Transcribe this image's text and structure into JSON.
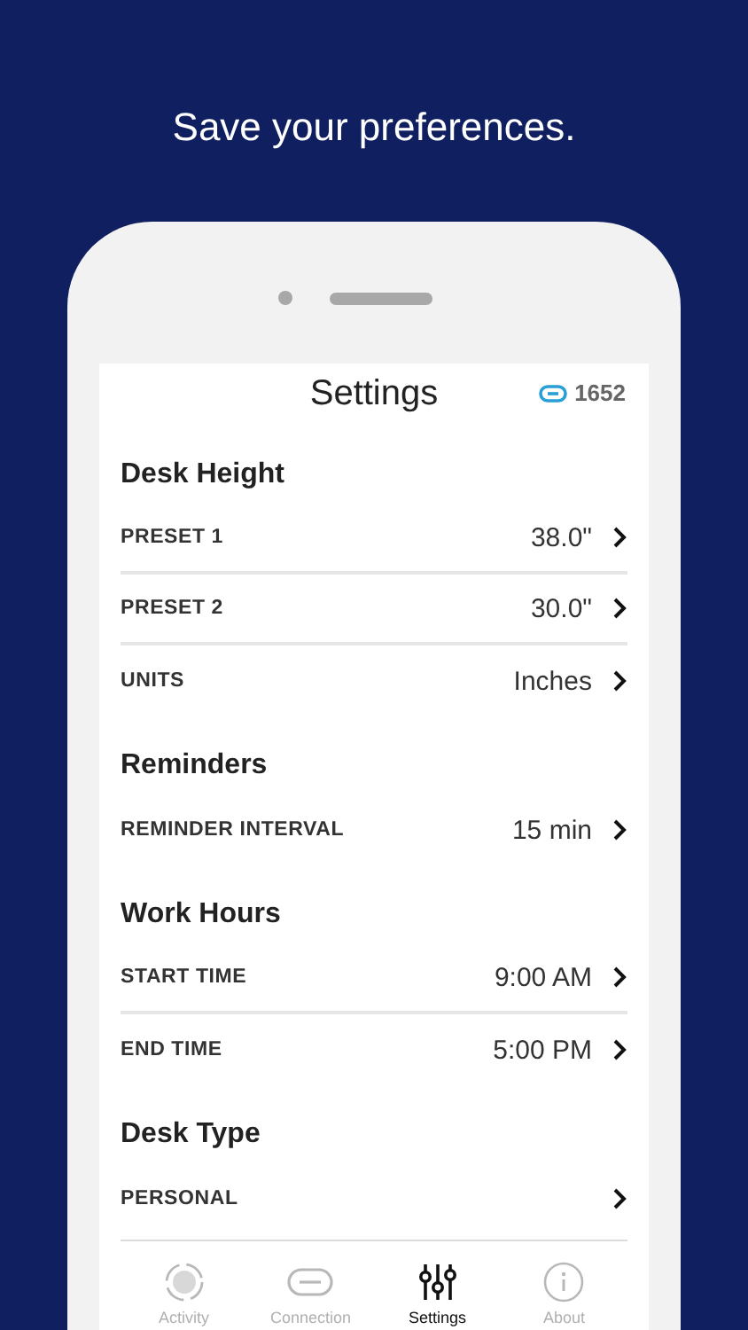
{
  "headline": "Save your preferences.",
  "screen": {
    "title": "Settings",
    "link_count": "1652"
  },
  "sections": [
    {
      "title": "Desk Height",
      "rows": [
        {
          "label": "PRESET 1",
          "value": "38.0\""
        },
        {
          "label": "PRESET 2",
          "value": "30.0\""
        },
        {
          "label": "UNITS",
          "value": "Inches"
        }
      ]
    },
    {
      "title": "Reminders",
      "rows": [
        {
          "label": "REMINDER INTERVAL",
          "value": "15 min"
        }
      ]
    },
    {
      "title": "Work Hours",
      "rows": [
        {
          "label": "START TIME",
          "value": "9:00 AM"
        },
        {
          "label": "END TIME",
          "value": "5:00 PM"
        }
      ]
    },
    {
      "title": "Desk Type",
      "rows": [
        {
          "label": "PERSONAL"
        }
      ]
    }
  ],
  "tabs": [
    {
      "kind": "activity",
      "label": "Activity",
      "selected": false
    },
    {
      "kind": "connection",
      "label": "Connection",
      "selected": false
    },
    {
      "kind": "settings",
      "label": "Settings",
      "selected": true
    },
    {
      "kind": "about",
      "label": "About",
      "selected": false
    }
  ]
}
